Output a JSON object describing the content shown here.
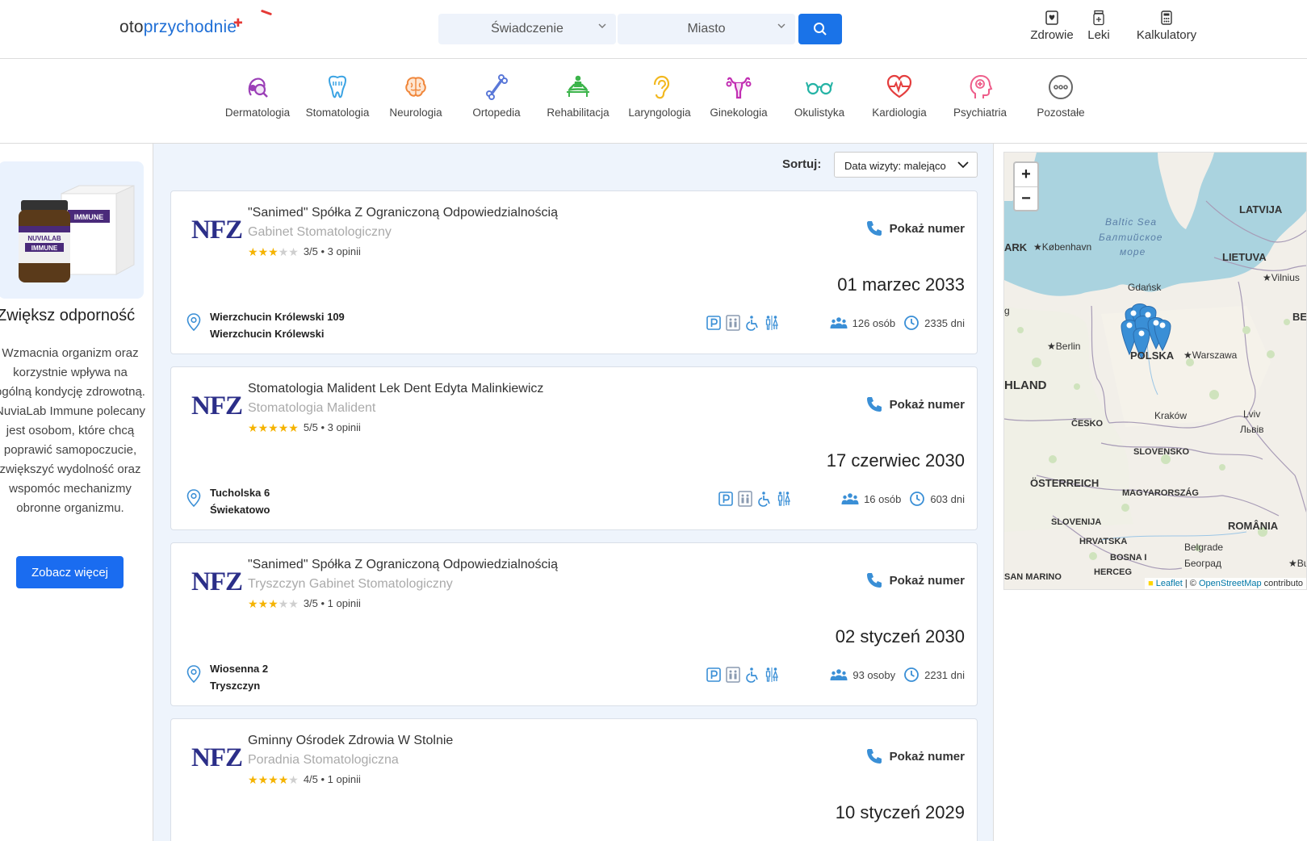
{
  "header": {
    "logo_part1": "oto",
    "logo_part2": "przychodnie",
    "search": {
      "service_placeholder": "Świadczenie",
      "city_placeholder": "Miasto"
    },
    "nav": [
      {
        "label": "Zdrowie",
        "icon": "heart-book-icon"
      },
      {
        "label": "Leki",
        "icon": "pill-bottle-icon"
      },
      {
        "label": "Kalkulatory",
        "icon": "calculator-icon"
      }
    ]
  },
  "categories": [
    {
      "label": "Dermatologia",
      "color": "#9b3fb7"
    },
    {
      "label": "Stomatologia",
      "color": "#3aa3e3"
    },
    {
      "label": "Neurologia",
      "color": "#f0863a"
    },
    {
      "label": "Ortopedia",
      "color": "#5a78d8"
    },
    {
      "label": "Rehabilitacja",
      "color": "#3cb44b"
    },
    {
      "label": "Laryngologia",
      "color": "#f2b81f"
    },
    {
      "label": "Ginekologia",
      "color": "#c22fb3"
    },
    {
      "label": "Okulistyka",
      "color": "#24b3a5"
    },
    {
      "label": "Kardiologia",
      "color": "#e43d3d"
    },
    {
      "label": "Psychiatria",
      "color": "#ee5d8a"
    },
    {
      "label": "Pozostałe",
      "color": "#666666"
    }
  ],
  "ad": {
    "title": "Zwiększ odporność",
    "text": "Wzmacnia organizm oraz korzystnie wpływa na ogólną kondycję zdrowotną. NuviaLab Immune polecany jest osobom, które chcą poprawić samopoczucie, zwiększyć wydolność oraz wspomóc mechanizmy obronne organizmu.",
    "button": "Zobacz więcej",
    "product_brand": "NUVIALAB",
    "product_name": "IMMUNE"
  },
  "sort": {
    "label": "Sortuj:",
    "value": "Data wizyty: malejąco"
  },
  "listings": [
    {
      "logo": "NFZ",
      "name": "\"Sanimed\" Spółka Z Ograniczoną Odpowiedzialnością",
      "subtitle": "Gabinet Stomatologiczny",
      "stars": 3,
      "rating": "3/5 • 3 opinii",
      "show_number": "Pokaż numer",
      "date": "01 marzec 2033",
      "address1": "Wierzchucin Królewski 109",
      "address2": "Wierzchucin Królewski",
      "people": "126 osób",
      "days": "2335 dni"
    },
    {
      "logo": "NFZ",
      "name": "Stomatologia Malident Lek Dent Edyta Malinkiewicz",
      "subtitle": "Stomatologia Malident",
      "stars": 5,
      "rating": "5/5 • 3 opinii",
      "show_number": "Pokaż numer",
      "date": "17 czerwiec 2030",
      "address1": "Tucholska 6",
      "address2": "Świekatowo",
      "people": "16 osób",
      "days": "603 dni"
    },
    {
      "logo": "NFZ",
      "name": "\"Sanimed\" Spółka Z Ograniczoną Odpowiedzialnością",
      "subtitle": "Tryszczyn Gabinet Stomatologiczny",
      "stars": 3,
      "rating": "3/5 • 1 opinii",
      "show_number": "Pokaż numer",
      "date": "02 styczeń 2030",
      "address1": "Wiosenna 2",
      "address2": "Tryszczyn",
      "people": "93 osoby",
      "days": "2231 dni"
    },
    {
      "logo": "NFZ",
      "name": "Gminny Ośrodek Zdrowia W Stolnie",
      "subtitle": "Poradnia Stomatologiczna",
      "stars": 4,
      "rating": "4/5 • 1 opinii",
      "show_number": "Pokaż numer",
      "date": "10 styczeń 2029",
      "address1": "",
      "address2": "",
      "people": "",
      "days": ""
    }
  ],
  "map": {
    "zoom_in": "+",
    "zoom_out": "−",
    "labels": {
      "latvija": "LATVIJA",
      "baltic1": "Baltic Sea",
      "baltic2": "Балтийское",
      "baltic3": "море",
      "ark": "ARK",
      "kobenhavn": "København",
      "lietuva": "LIETUVA",
      "vilnius": "Vilnius",
      "g": "g",
      "gdansk": "Gdańsk",
      "bel": "BEL",
      "berlin": "Berlin",
      "polska": "POLSKA",
      "warszawa": "Warszawa",
      "hland": "HLAND",
      "krakow": "Kraków",
      "lviv1": "Lviv",
      "lviv2": "Львів",
      "cesko": "ČESKO",
      "slovensko": "SLOVENSKO",
      "osterreich": "ÖSTERREICH",
      "magyar": "MAGYARORSZÁG",
      "slovenija": "SLOVENIJA",
      "romania": "ROMÂNIA",
      "hrvatska": "HRVATSKA",
      "belgrade1": "Belgrade",
      "belgrade2": "Београд",
      "bosna": "BOSNA I",
      "herceg": "HERCEG",
      "buc": "Buc",
      "sanmarino": "SAN MARINO"
    },
    "attribution_leaflet": "Leaflet",
    "attribution_sep": " | © ",
    "attribution_osm": "OpenStreetMap",
    "attribution_rest": " contributo"
  }
}
